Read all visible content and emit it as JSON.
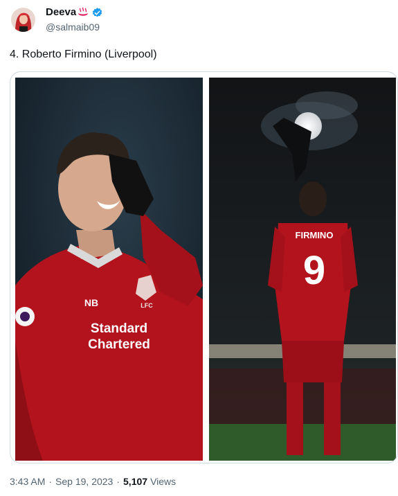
{
  "author": {
    "name": "Deeva",
    "handle": "@salmaib09",
    "name_emoji_icon": "hot-springs-icon",
    "verified_icon": "verified-badge-icon",
    "accent_color": "#1d9bf0"
  },
  "tweet": {
    "text": "4. Roberto Firmino (Liverpool)"
  },
  "media": {
    "left_photo": {
      "sponsor_line1": "Standard",
      "sponsor_line2": "Chartered",
      "crest_text": "LFC",
      "kit_brand": "NB"
    },
    "right_photo": {
      "shirt_name": "FIRMINO",
      "shirt_number": "9"
    },
    "kit_color": "#b3131d"
  },
  "meta": {
    "time": "3:43 AM",
    "separator": "·",
    "date": "Sep 19, 2023",
    "views_count": "5,107",
    "views_label": "Views"
  }
}
